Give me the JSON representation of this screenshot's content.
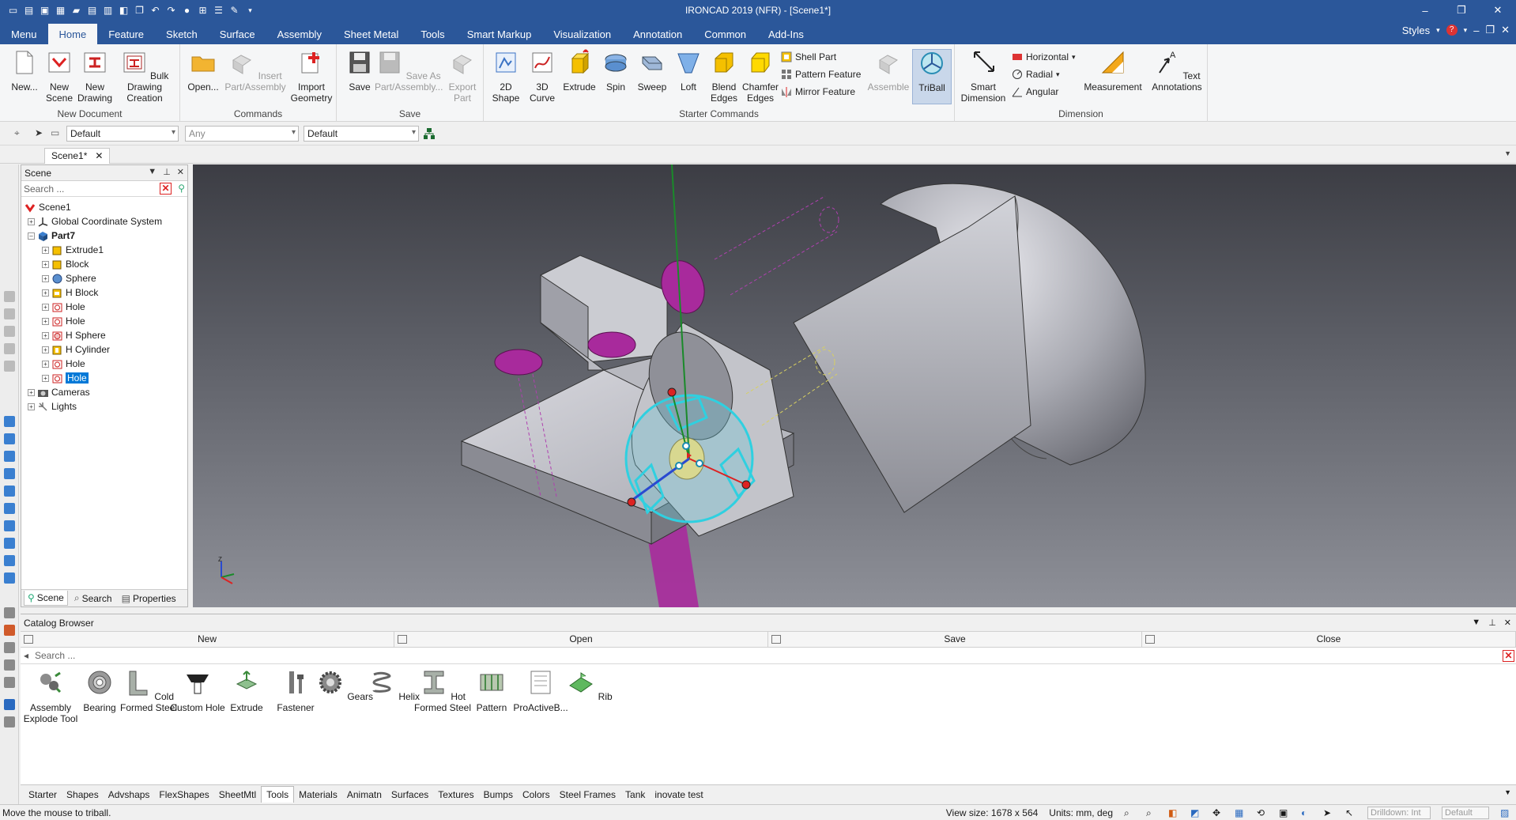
{
  "window": {
    "title": "IRONCAD 2019 (NFR) - [Scene1*]",
    "controls": [
      "–",
      "❐",
      "✕"
    ]
  },
  "qat_icons": [
    "new-file-icon",
    "save-icon",
    "pdf-icon",
    "print-icon",
    "open-icon",
    "save-as-icon",
    "catalog-icon",
    "properties-icon",
    "copy-icon",
    "undo-icon",
    "redo-icon",
    "globe-icon",
    "tree-icon",
    "grid-icon",
    "paint-icon",
    "dropdown-icon"
  ],
  "ribbon_tabs": [
    "Menu",
    "Home",
    "Feature",
    "Sketch",
    "Surface",
    "Assembly",
    "Sheet Metal",
    "Tools",
    "Smart Markup",
    "Visualization",
    "Annotation",
    "Common",
    "Add-Ins"
  ],
  "active_tab": "Home",
  "styles_label": "Styles",
  "ribbon": {
    "new_document": {
      "name": "New Document",
      "buttons": [
        {
          "label": "New...",
          "icon": "new-document-icon"
        },
        {
          "label": "New Scene",
          "icon": "new-scene-icon"
        },
        {
          "label": "New Drawing",
          "icon": "new-drawing-icon"
        },
        {
          "label": "Bulk Drawing Creation",
          "icon": "bulk-drawing-icon"
        }
      ]
    },
    "commands": {
      "name": "Commands",
      "buttons": [
        {
          "label": "Open...",
          "icon": "open-folder-icon"
        },
        {
          "label": "Insert Part/Assembly",
          "icon": "insert-part-icon",
          "disabled": true
        },
        {
          "label": "Import Geometry",
          "icon": "import-geometry-icon"
        }
      ]
    },
    "save": {
      "name": "Save",
      "buttons": [
        {
          "label": "Save",
          "icon": "save-disk-icon"
        },
        {
          "label": "Save As Part/Assembly...",
          "icon": "save-as-part-icon",
          "disabled": true
        },
        {
          "label": "Export Part",
          "icon": "export-part-icon",
          "disabled": true
        }
      ]
    },
    "starter": {
      "name": "Starter Commands",
      "buttons": [
        {
          "label": "2D Shape",
          "icon": "2d-shape-icon"
        },
        {
          "label": "3D Curve",
          "icon": "3d-curve-icon"
        },
        {
          "label": "Extrude",
          "icon": "extrude-icon"
        },
        {
          "label": "Spin",
          "icon": "spin-icon"
        },
        {
          "label": "Sweep",
          "icon": "sweep-icon"
        },
        {
          "label": "Loft",
          "icon": "loft-icon"
        },
        {
          "label": "Blend Edges",
          "icon": "blend-edges-icon"
        },
        {
          "label": "Chamfer Edges",
          "icon": "chamfer-edges-icon"
        }
      ],
      "small": [
        "Shell Part",
        "Pattern Feature",
        "Mirror Feature"
      ],
      "assemble": "Assemble",
      "triball": "TriBall"
    },
    "dimension": {
      "name": "Dimension",
      "smart": "Smart Dimension",
      "small": [
        "Horizontal",
        "Radial",
        "Angular"
      ],
      "measurement": "Measurement",
      "text": "Text Annotations"
    }
  },
  "toolbar": {
    "combo1": "Default",
    "combo2": "Any",
    "combo3": "Default"
  },
  "doc_tab": "Scene1*",
  "scene_panel": {
    "title": "Scene",
    "search_placeholder": "Search ...",
    "tree": [
      {
        "label": "Scene1",
        "icon": "scene-icon"
      },
      {
        "label": "Global Coordinate System",
        "icon": "coordinate-system-icon"
      },
      {
        "label": "Part7",
        "icon": "part-icon",
        "bold": true
      },
      {
        "label": "Extrude1",
        "icon": "extrude-feature-icon"
      },
      {
        "label": "Block",
        "icon": "block-feature-icon"
      },
      {
        "label": "Sphere",
        "icon": "sphere-feature-icon"
      },
      {
        "label": "H Block",
        "icon": "hblock-feature-icon"
      },
      {
        "label": "Hole",
        "icon": "hole-feature-icon"
      },
      {
        "label": "Hole",
        "icon": "hole-feature-icon"
      },
      {
        "label": "H Sphere",
        "icon": "hsphere-feature-icon"
      },
      {
        "label": "H Cylinder",
        "icon": "hcylinder-feature-icon"
      },
      {
        "label": "Hole",
        "icon": "hole-feature-icon"
      },
      {
        "label": "Hole",
        "icon": "hole-feature-icon",
        "selected": true
      },
      {
        "label": "Cameras",
        "icon": "cameras-icon"
      },
      {
        "label": "Lights",
        "icon": "lights-icon"
      }
    ],
    "tabs": [
      "Scene",
      "Search",
      "Properties"
    ]
  },
  "catalog": {
    "title": "Catalog Browser",
    "bar": [
      "New",
      "Open",
      "Save",
      "Close"
    ],
    "search_placeholder": "Search ...",
    "items": [
      {
        "label": "Assembly Explode Tool",
        "icon": "assembly-explode-icon"
      },
      {
        "label": "Bearing",
        "icon": "bearing-icon"
      },
      {
        "label": "Cold Formed Steel",
        "icon": "cold-formed-steel-icon"
      },
      {
        "label": "Custom Hole",
        "icon": "custom-hole-icon"
      },
      {
        "label": "Extrude",
        "icon": "catalog-extrude-icon"
      },
      {
        "label": "Fastener",
        "icon": "fastener-icon"
      },
      {
        "label": "Gears",
        "icon": "gears-icon"
      },
      {
        "label": "Helix",
        "icon": "helix-icon"
      },
      {
        "label": "Hot Formed Steel",
        "icon": "hot-formed-steel-icon"
      },
      {
        "label": "Pattern",
        "icon": "pattern-icon"
      },
      {
        "label": "ProActiveB...",
        "icon": "proactive-icon"
      },
      {
        "label": "Rib",
        "icon": "rib-icon"
      }
    ],
    "tabs": [
      "Starter",
      "Shapes",
      "Advshaps",
      "FlexShapes",
      "SheetMtl",
      "Tools",
      "Materials",
      "Animatn",
      "Surfaces",
      "Textures",
      "Bumps",
      "Colors",
      "Steel Frames",
      "Tank",
      "inovate test"
    ],
    "active_tab": "Tools"
  },
  "status": {
    "message": "Move the mouse to triball.",
    "view_size": "View size: 1678 x 564",
    "units": "Units: mm, deg",
    "drilldown": "Drilldown: Int",
    "default_combo": "Default"
  },
  "colors": {
    "accent": "#2b579a",
    "selection": "#0078d7",
    "hole_magenta": "#b02ab0",
    "triball_cyan": "#2fd0e0"
  }
}
